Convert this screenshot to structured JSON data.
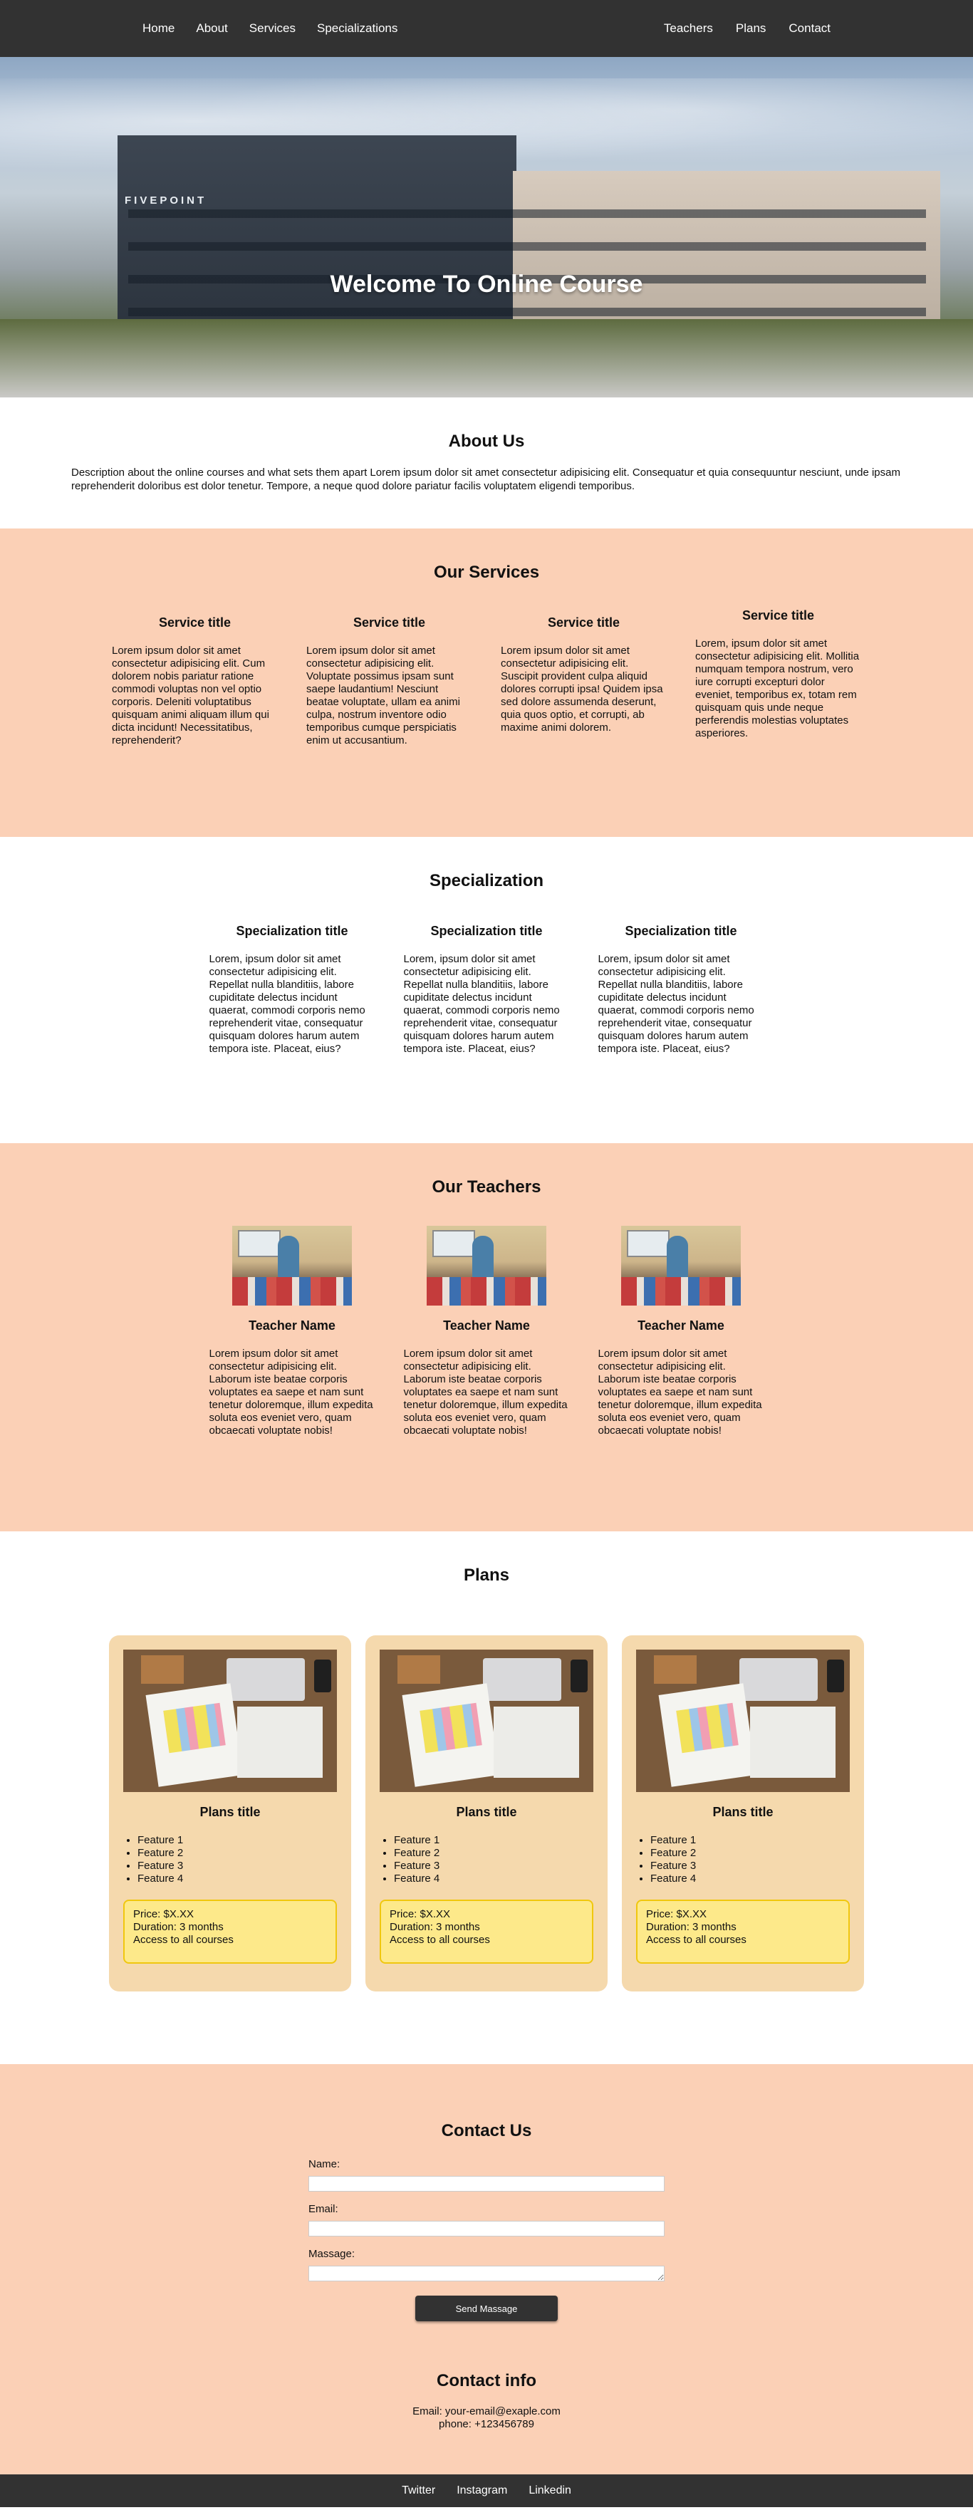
{
  "nav": {
    "left": [
      "Home",
      "About",
      "Services",
      "Specializations"
    ],
    "right": [
      "Teachers",
      "Plans",
      "Contact"
    ]
  },
  "hero": {
    "title": "Welcome To Online Course",
    "building_sign": "FIVEPOINT"
  },
  "about": {
    "title": "About Us",
    "text": "Description about the online courses and what sets them apart Lorem ipsum dolor sit amet consectetur adipisicing elit. Consequatur et quia consequuntur nesciunt, unde ipsam reprehenderit doloribus est dolor tenetur. Tempore, a neque quod dolore pariatur facilis voluptatem eligendi temporibus."
  },
  "services": {
    "title": "Our Services",
    "items": [
      {
        "title": "Service title",
        "text": "Lorem ipsum dolor sit amet consectetur adipisicing elit. Cum dolorem nobis pariatur ratione commodi voluptas non vel optio corporis. Deleniti voluptatibus quisquam animi aliquam illum qui dicta incidunt! Necessitatibus, reprehenderit?"
      },
      {
        "title": "Service title",
        "text": "Lorem ipsum dolor sit amet consectetur adipisicing elit. Voluptate possimus ipsam sunt saepe laudantium! Nesciunt beatae voluptate, ullam ea animi culpa, nostrum inventore odio temporibus cumque perspiciatis enim ut accusantium."
      },
      {
        "title": "Service title",
        "text": "Lorem ipsum dolor sit amet consectetur adipisicing elit. Suscipit provident culpa aliquid dolores corrupti ipsa! Quidem ipsa sed dolore assumenda deserunt, quia quos optio, et corrupti, ab maxime animi dolorem."
      },
      {
        "title": "Service title",
        "text": "Lorem, ipsum dolor sit amet consectetur adipisicing elit. Mollitia numquam tempora nostrum, vero iure corrupti excepturi dolor eveniet, temporibus ex, totam rem quisquam quis unde neque perferendis molestias voluptates asperiores."
      }
    ]
  },
  "specialization": {
    "title": "Specialization",
    "items": [
      {
        "title": "Specialization title",
        "text": "Lorem, ipsum dolor sit amet consectetur adipisicing elit. Repellat nulla blanditiis, labore cupiditate delectus incidunt quaerat, commodi corporis nemo reprehenderit vitae, consequatur quisquam dolores harum autem tempora iste. Placeat, eius?"
      },
      {
        "title": "Specialization title",
        "text": "Lorem, ipsum dolor sit amet consectetur adipisicing elit. Repellat nulla blanditiis, labore cupiditate delectus incidunt quaerat, commodi corporis nemo reprehenderit vitae, consequatur quisquam dolores harum autem tempora iste. Placeat, eius?"
      },
      {
        "title": "Specialization title",
        "text": "Lorem, ipsum dolor sit amet consectetur adipisicing elit. Repellat nulla blanditiis, labore cupiditate delectus incidunt quaerat, commodi corporis nemo reprehenderit vitae, consequatur quisquam dolores harum autem tempora iste. Placeat, eius?"
      }
    ]
  },
  "teachers": {
    "title": "Our Teachers",
    "items": [
      {
        "name": "Teacher Name",
        "text": "Lorem ipsum dolor sit amet consectetur adipisicing elit. Laborum iste beatae corporis voluptates ea saepe et nam sunt tenetur doloremque, illum expedita soluta eos eveniet vero, quam obcaecati voluptate nobis!"
      },
      {
        "name": "Teacher Name",
        "text": "Lorem ipsum dolor sit amet consectetur adipisicing elit. Laborum iste beatae corporis voluptates ea saepe et nam sunt tenetur doloremque, illum expedita soluta eos eveniet vero, quam obcaecati voluptate nobis!"
      },
      {
        "name": "Teacher Name",
        "text": "Lorem ipsum dolor sit amet consectetur adipisicing elit. Laborum iste beatae corporis voluptates ea saepe et nam sunt tenetur doloremque, illum expedita soluta eos eveniet vero, quam obcaecati voluptate nobis!"
      }
    ]
  },
  "plans": {
    "title": "Plans",
    "items": [
      {
        "title": "Plans title",
        "features": [
          "Feature 1",
          "Feature 2",
          "Feature 3",
          "Feature 4"
        ],
        "price": "Price: $X.XX",
        "duration": "Duration: 3 months",
        "access": "Access to all courses"
      },
      {
        "title": "Plans title",
        "features": [
          "Feature 1",
          "Feature 2",
          "Feature 3",
          "Feature 4"
        ],
        "price": "Price: $X.XX",
        "duration": "Duration: 3 months",
        "access": "Access to all courses"
      },
      {
        "title": "Plans title",
        "features": [
          "Feature 1",
          "Feature 2",
          "Feature 3",
          "Feature 4"
        ],
        "price": "Price: $X.XX",
        "duration": "Duration: 3 months",
        "access": "Access to all courses"
      }
    ]
  },
  "contact": {
    "title": "Contact Us",
    "name_label": "Name:",
    "email_label": "Email:",
    "message_label": "Massage:",
    "submit_label": "Send Massage",
    "info_title": "Contact info",
    "email": "Email: your-email@exaple.com",
    "phone": "phone: +123456789"
  },
  "footer": {
    "links": [
      "Twitter",
      "Instagram",
      "Linkedin"
    ]
  },
  "colors": {
    "nav_bg": "#323232",
    "peach": "#fbd0b6",
    "plan_card": "#f5d9ad",
    "price_box": "#fde98a",
    "price_border": "#f0c70e"
  }
}
